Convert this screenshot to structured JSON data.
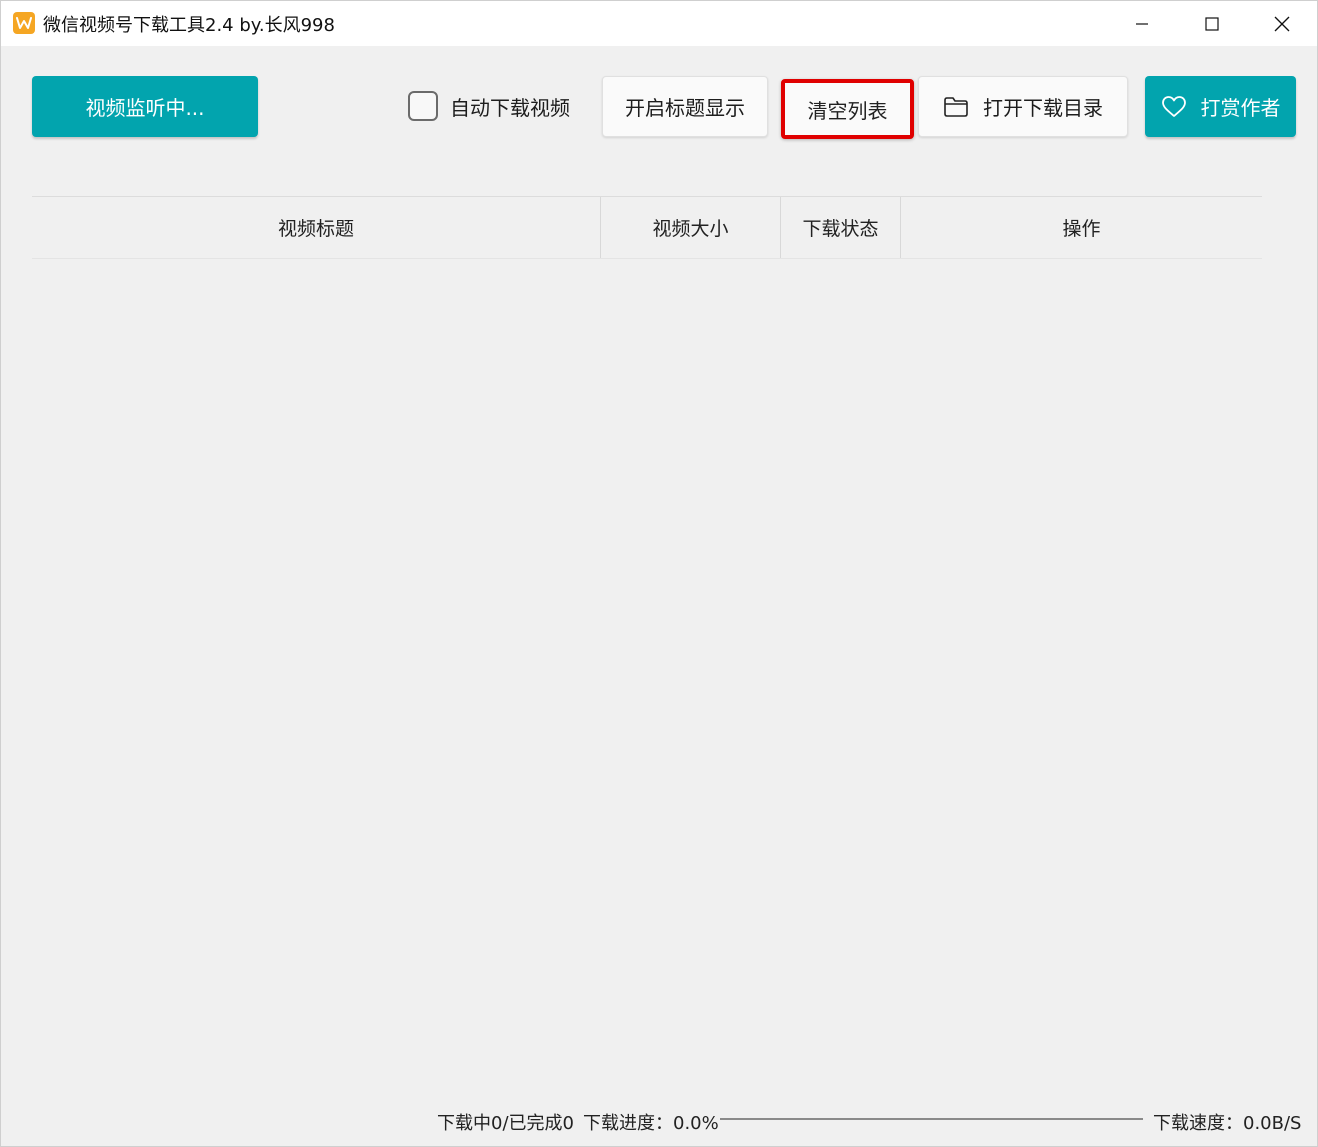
{
  "window": {
    "title": "微信视频号下载工具2.4 by.长风998",
    "icon": "app-logo-icon"
  },
  "toolbar": {
    "monitor_label": "视频监听中...",
    "auto_download_label": "自动下载视频",
    "auto_download_checked": false,
    "title_toggle_label": "开启标题显示",
    "clear_list_label": "清空列表",
    "open_dir_label": "打开下载目录",
    "open_dir_icon": "folder-icon",
    "reward_label": "打赏作者",
    "reward_icon": "heart-icon",
    "accent_color": "#02a4ae",
    "highlight_color": "#e00000"
  },
  "table": {
    "columns": [
      "视频标题",
      "视频大小",
      "下载状态",
      "操作"
    ],
    "rows": []
  },
  "status": {
    "counts": "下载中0/已完成0",
    "progress_label": "下载进度：0.0%",
    "progress_value": 0.0,
    "speed_label": "下载速度：0.0B/S"
  }
}
